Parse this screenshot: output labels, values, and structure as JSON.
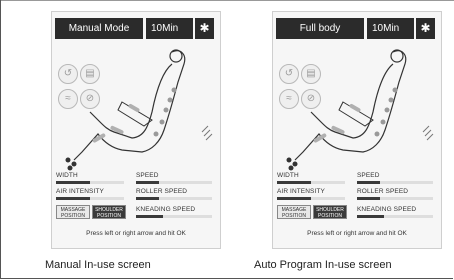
{
  "screens": [
    {
      "mode_label": "Manual Mode",
      "time_label": "10Min",
      "bluetooth_icon": "bluetooth-icon",
      "labels": {
        "width": "WIDTH",
        "speed": "SPEED",
        "air_intensity": "AIR INTENSITY",
        "roller_speed": "ROLLER SPEED",
        "kneading_speed": "KNEADING SPEED"
      },
      "levels": {
        "width": 0.5,
        "speed": 0.3,
        "air_intensity": 0.5,
        "roller_speed": 0.3,
        "kneading_speed": 0.35
      },
      "buttons": {
        "massage_position": "MASSAGE POSITION",
        "shoulder_position": "SHOULDER POSITION"
      },
      "hint": "Press left or right arrow and hit OK",
      "caption": "Manual In-use screen"
    },
    {
      "mode_label": "Full body",
      "time_label": "10Min",
      "bluetooth_icon": "bluetooth-icon",
      "labels": {
        "width": "WIDTH",
        "speed": "SPEED",
        "air_intensity": "AIR INTENSITY",
        "roller_speed": "ROLLER SPEED",
        "kneading_speed": "KNEADING SPEED"
      },
      "levels": {
        "width": 0.5,
        "speed": 0.3,
        "air_intensity": 0.5,
        "roller_speed": 0.3,
        "kneading_speed": 0.35
      },
      "buttons": {
        "massage_position": "MASSAGE POSITION",
        "shoulder_position": "SHOULDER POSITION"
      },
      "hint": "Press left or right arrow and hit OK",
      "caption": "Auto Program In-use screen"
    }
  ],
  "colors": {
    "header_bg": "#2b2b2b",
    "bar_fill": "#3a3a3a",
    "bar_track": "#dedede",
    "panel_bg": "#f6f6f6"
  }
}
